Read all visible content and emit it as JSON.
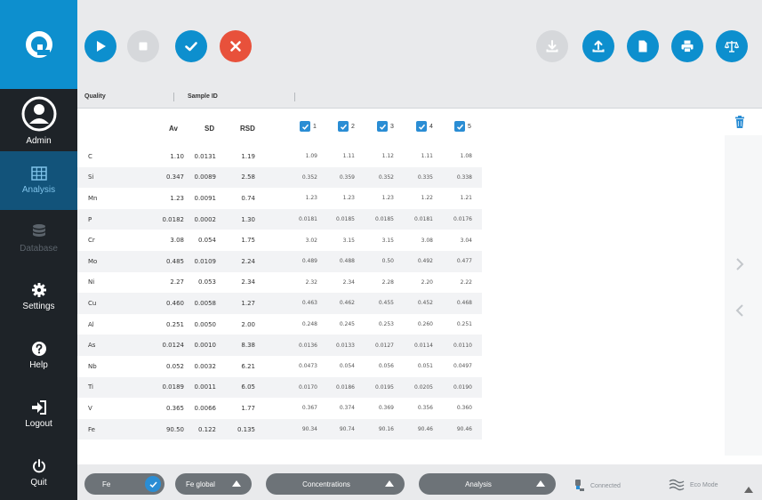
{
  "sidebar": {
    "items": [
      {
        "label": "Admin",
        "icon": "user-icon"
      },
      {
        "label": "Analysis",
        "icon": "grid-icon"
      },
      {
        "label": "Database",
        "icon": "database-icon"
      },
      {
        "label": "Settings",
        "icon": "gear-icon"
      },
      {
        "label": "Help",
        "icon": "help-icon"
      },
      {
        "label": "Logout",
        "icon": "logout-icon"
      },
      {
        "label": "Quit",
        "icon": "power-icon"
      }
    ]
  },
  "colors": {
    "accent": "#0d8fce",
    "sidebar": "#1e2328",
    "stop": "#e8513b",
    "checkbox": "#2a8dd4"
  },
  "header": {
    "quality_label": "Quality",
    "sample_id_label": "Sample ID"
  },
  "table": {
    "headers": {
      "av": "Av",
      "sd": "SD",
      "rsd": "RSD"
    },
    "run_labels": [
      "1",
      "2",
      "3",
      "4",
      "5"
    ],
    "rows": [
      {
        "el": "C",
        "av": "1.10",
        "sd": "0.0131",
        "rsd": "1.19",
        "runs": [
          "1.09",
          "1.11",
          "1.12",
          "1.11",
          "1.08"
        ]
      },
      {
        "el": "Si",
        "av": "0.347",
        "sd": "0.0089",
        "rsd": "2.58",
        "runs": [
          "0.352",
          "0.359",
          "0.352",
          "0.335",
          "0.338"
        ]
      },
      {
        "el": "Mn",
        "av": "1.23",
        "sd": "0.0091",
        "rsd": "0.74",
        "runs": [
          "1.23",
          "1.23",
          "1.23",
          "1.22",
          "1.21"
        ]
      },
      {
        "el": "P",
        "av": "0.0182",
        "sd": "0.0002",
        "rsd": "1.30",
        "runs": [
          "0.0181",
          "0.0185",
          "0.0185",
          "0.0181",
          "0.0176"
        ]
      },
      {
        "el": "Cr",
        "av": "3.08",
        "sd": "0.054",
        "rsd": "1.75",
        "runs": [
          "3.02",
          "3.15",
          "3.15",
          "3.08",
          "3.04"
        ]
      },
      {
        "el": "Mo",
        "av": "0.485",
        "sd": "0.0109",
        "rsd": "2.24",
        "runs": [
          "0.489",
          "0.488",
          "0.50",
          "0.492",
          "0.477"
        ]
      },
      {
        "el": "Ni",
        "av": "2.27",
        "sd": "0.053",
        "rsd": "2.34",
        "runs": [
          "2.32",
          "2.34",
          "2.28",
          "2.20",
          "2.22"
        ]
      },
      {
        "el": "Cu",
        "av": "0.460",
        "sd": "0.0058",
        "rsd": "1.27",
        "runs": [
          "0.463",
          "0.462",
          "0.455",
          "0.452",
          "0.468"
        ]
      },
      {
        "el": "Al",
        "av": "0.251",
        "sd": "0.0050",
        "rsd": "2.00",
        "runs": [
          "0.248",
          "0.245",
          "0.253",
          "0.260",
          "0.251"
        ]
      },
      {
        "el": "As",
        "av": "0.0124",
        "sd": "0.0010",
        "rsd": "8.38",
        "runs": [
          "0.0136",
          "0.0133",
          "0.0127",
          "0.0114",
          "0.0110"
        ]
      },
      {
        "el": "Nb",
        "av": "0.052",
        "sd": "0.0032",
        "rsd": "6.21",
        "runs": [
          "0.0473",
          "0.054",
          "0.056",
          "0.051",
          "0.0497"
        ]
      },
      {
        "el": "Ti",
        "av": "0.0189",
        "sd": "0.0011",
        "rsd": "6.05",
        "runs": [
          "0.0170",
          "0.0186",
          "0.0195",
          "0.0205",
          "0.0190"
        ]
      },
      {
        "el": "V",
        "av": "0.365",
        "sd": "0.0066",
        "rsd": "1.77",
        "runs": [
          "0.367",
          "0.374",
          "0.369",
          "0.356",
          "0.360"
        ]
      },
      {
        "el": "Fe",
        "av": "90.50",
        "sd": "0.122",
        "rsd": "0.135",
        "runs": [
          "90.34",
          "90.74",
          "90.16",
          "90.46",
          "90.46"
        ]
      }
    ]
  },
  "footer": {
    "base_label": "Fe",
    "mode_label": "Fe global",
    "display_label": "Concentrations",
    "view_label": "Analysis",
    "connected_label": "Connected",
    "eco_label": "Eco Mode"
  }
}
